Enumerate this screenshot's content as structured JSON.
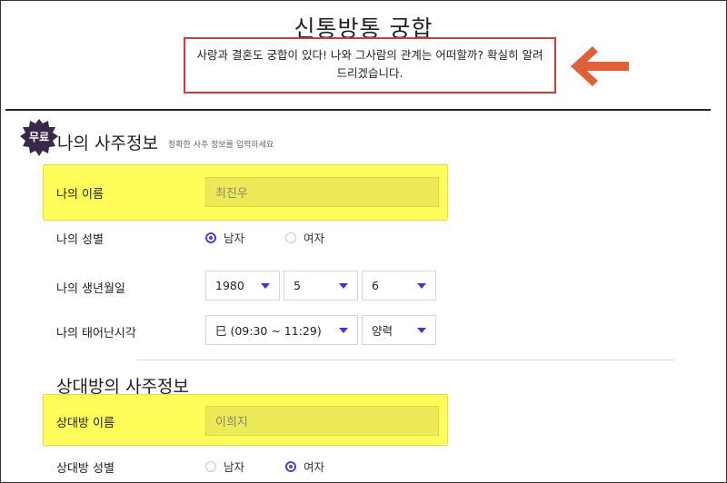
{
  "header": {
    "title": "신통방통 궁합",
    "notice": "사랑과 결혼도 궁합이 있다! 나와 그사람의 관계는 어떠할까? 확실히 알려드리겠습니다."
  },
  "my_section": {
    "badge": "무료",
    "title": "나의 사주정보",
    "subtitle": "정확한 사주 정보를 입력하세요",
    "name_label": "나의 이름",
    "name_value": "최진우",
    "gender_label": "나의 성별",
    "gender_options": [
      "남자",
      "여자"
    ],
    "gender_selected": "남자",
    "birth_label": "나의 생년월일",
    "birth_year": "1980",
    "birth_month": "5",
    "birth_day": "6",
    "time_label": "나의 태어난시각",
    "time_value": "巳 (09:30 ~ 11:29)",
    "calendar_value": "양력"
  },
  "partner_section": {
    "title": "상대방의 사주정보",
    "name_label": "상대방 이름",
    "name_value": "이희지",
    "gender_label": "상대방 성별",
    "gender_options": [
      "남자",
      "여자"
    ],
    "gender_selected": "여자"
  },
  "colors": {
    "highlight": "#fffd5a",
    "accent": "#5b3ad1",
    "notice_border": "#d23b3b",
    "arrow": "#e0603a"
  },
  "icons": {
    "arrow": "arrow-left-icon",
    "radio": "radio-icon",
    "caret": "chevron-down-icon"
  }
}
